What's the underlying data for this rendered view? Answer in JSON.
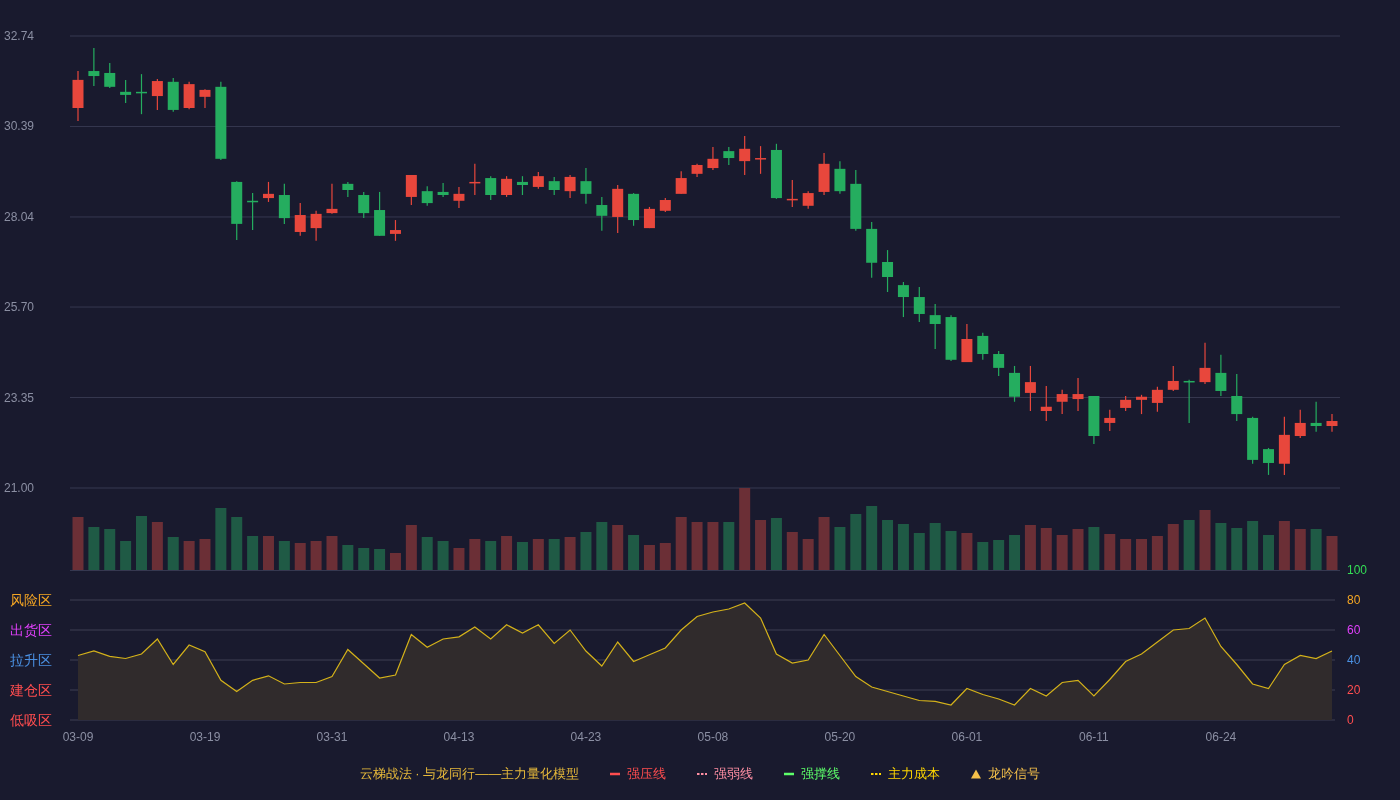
{
  "price_chart": {
    "chart_data": {
      "type": "candlestick",
      "grid": true,
      "ylim": [
        21.0,
        32.74
      ],
      "yticks": [
        {
          "value": 32.74,
          "label": "32.74"
        },
        {
          "value": 30.39,
          "label": "30.39"
        },
        {
          "value": 28.04,
          "label": "28.04"
        },
        {
          "value": 25.7,
          "label": "25.70"
        },
        {
          "value": 23.35,
          "label": "23.35"
        },
        {
          "value": 21.0,
          "label": "21.00"
        }
      ],
      "categories": [
        null,
        null,
        null,
        null,
        null,
        null,
        null,
        null,
        null,
        null,
        null,
        null,
        null,
        null,
        null,
        null,
        null,
        null,
        null,
        null,
        null,
        null,
        null,
        null,
        null,
        null,
        null,
        null,
        null,
        null,
        null,
        null,
        null,
        null,
        null,
        null,
        null,
        null,
        null,
        null,
        null,
        null,
        null,
        null,
        null,
        null,
        null,
        null,
        null,
        null,
        null,
        null,
        null,
        null,
        null,
        null,
        null,
        null,
        null,
        null,
        null,
        null,
        null,
        null,
        null,
        null,
        null,
        null,
        null,
        null,
        null,
        null,
        null,
        null,
        null,
        null,
        null,
        null,
        null,
        null
      ],
      "ohlc": [
        [
          30.87,
          31.83,
          30.53,
          31.6
        ],
        [
          31.83,
          32.43,
          31.44,
          31.7
        ],
        [
          31.78,
          32.04,
          31.39,
          31.42
        ],
        [
          31.29,
          31.6,
          31.0,
          31.21
        ],
        [
          31.29,
          31.75,
          30.71,
          31.26
        ],
        [
          31.18,
          31.62,
          30.82,
          31.57
        ],
        [
          31.55,
          31.65,
          30.77,
          30.82
        ],
        [
          30.87,
          31.55,
          30.84,
          31.49
        ],
        [
          31.16,
          31.36,
          30.87,
          31.34
        ],
        [
          31.42,
          31.55,
          29.52,
          29.55
        ],
        [
          28.95,
          28.97,
          27.44,
          27.86
        ],
        [
          28.46,
          28.66,
          27.7,
          28.43
        ],
        [
          28.53,
          28.95,
          28.43,
          28.64
        ],
        [
          28.61,
          28.9,
          27.86,
          28.01
        ],
        [
          27.65,
          28.4,
          27.55,
          28.09
        ],
        [
          27.75,
          28.2,
          27.42,
          28.12
        ],
        [
          28.14,
          28.9,
          28.12,
          28.25
        ],
        [
          28.9,
          28.95,
          28.56,
          28.74
        ],
        [
          28.61,
          28.69,
          28.01,
          28.14
        ],
        [
          28.22,
          28.69,
          27.55,
          27.55
        ],
        [
          27.6,
          27.96,
          27.42,
          27.7
        ],
        [
          28.56,
          29.13,
          28.35,
          29.13
        ],
        [
          28.71,
          28.84,
          28.33,
          28.4
        ],
        [
          28.69,
          28.92,
          28.56,
          28.61
        ],
        [
          28.46,
          28.82,
          28.27,
          28.64
        ],
        [
          28.92,
          29.42,
          28.61,
          28.95
        ],
        [
          29.05,
          29.1,
          28.48,
          28.61
        ],
        [
          28.61,
          29.1,
          28.56,
          29.03
        ],
        [
          28.95,
          29.1,
          28.61,
          28.87
        ],
        [
          28.82,
          29.21,
          28.77,
          29.1
        ],
        [
          28.97,
          29.08,
          28.61,
          28.74
        ],
        [
          28.71,
          29.13,
          28.53,
          29.08
        ],
        [
          28.97,
          29.31,
          28.38,
          28.64
        ],
        [
          28.35,
          28.56,
          27.68,
          28.07
        ],
        [
          28.04,
          28.87,
          27.62,
          28.77
        ],
        [
          28.64,
          28.66,
          27.81,
          27.96
        ],
        [
          27.75,
          28.3,
          27.75,
          28.25
        ],
        [
          28.2,
          28.53,
          28.17,
          28.48
        ],
        [
          28.64,
          29.23,
          28.64,
          29.05
        ],
        [
          29.16,
          29.42,
          29.08,
          29.39
        ],
        [
          29.31,
          29.86,
          29.26,
          29.55
        ],
        [
          29.75,
          29.86,
          29.39,
          29.57
        ],
        [
          29.49,
          30.14,
          29.13,
          29.81
        ],
        [
          29.55,
          29.88,
          29.16,
          29.57
        ],
        [
          29.78,
          29.94,
          28.51,
          28.53
        ],
        [
          28.48,
          29.0,
          28.3,
          28.51
        ],
        [
          28.33,
          28.71,
          28.25,
          28.66
        ],
        [
          28.69,
          29.7,
          28.61,
          29.42
        ],
        [
          29.29,
          29.49,
          28.64,
          28.71
        ],
        [
          28.9,
          29.26,
          27.68,
          27.73
        ],
        [
          27.73,
          27.91,
          26.46,
          26.85
        ],
        [
          26.87,
          27.18,
          26.09,
          26.48
        ],
        [
          26.27,
          26.35,
          25.44,
          25.96
        ],
        [
          25.96,
          26.22,
          25.31,
          25.52
        ],
        [
          25.49,
          25.78,
          24.61,
          25.26
        ],
        [
          25.44,
          25.49,
          24.3,
          24.33
        ],
        [
          24.27,
          25.26,
          24.27,
          24.87
        ],
        [
          24.95,
          25.03,
          24.33,
          24.48
        ],
        [
          24.48,
          24.56,
          23.91,
          24.12
        ],
        [
          23.99,
          24.17,
          23.24,
          23.37
        ],
        [
          23.47,
          24.17,
          23.0,
          23.75
        ],
        [
          23.0,
          23.65,
          22.74,
          23.11
        ],
        [
          23.24,
          23.55,
          22.92,
          23.44
        ],
        [
          23.31,
          23.86,
          23.0,
          23.44
        ],
        [
          23.39,
          23.39,
          22.14,
          22.35
        ],
        [
          22.69,
          23.03,
          22.48,
          22.82
        ],
        [
          23.08,
          23.39,
          23.0,
          23.29
        ],
        [
          23.29,
          23.42,
          22.92,
          23.37
        ],
        [
          23.21,
          23.63,
          22.98,
          23.55
        ],
        [
          23.55,
          24.17,
          23.52,
          23.78
        ],
        [
          23.78,
          23.81,
          22.69,
          23.75
        ],
        [
          23.75,
          24.77,
          23.7,
          24.12
        ],
        [
          23.99,
          24.46,
          23.39,
          23.52
        ],
        [
          23.39,
          23.96,
          22.74,
          22.92
        ],
        [
          22.82,
          22.85,
          21.63,
          21.73
        ],
        [
          22.01,
          22.04,
          21.34,
          21.65
        ],
        [
          21.63,
          22.85,
          21.34,
          22.38
        ],
        [
          22.35,
          23.03,
          22.3,
          22.69
        ],
        [
          22.69,
          23.24,
          22.46,
          22.61
        ],
        [
          22.61,
          22.92,
          22.46,
          22.74
        ]
      ]
    }
  },
  "indicator_chart": {
    "zones": [
      {
        "label": "风险区",
        "color": "#f5a623"
      },
      {
        "label": "出货区",
        "color": "#e040fb"
      },
      {
        "label": "拉升区",
        "color": "#4a90e2"
      },
      {
        "label": "建仓区",
        "color": "#ff4d4f"
      },
      {
        "label": "低吸区",
        "color": "#ff4d4f"
      }
    ],
    "chart_data": {
      "type": "area",
      "grid": true,
      "ylim": [
        0,
        100
      ],
      "categories": [
        "03-09",
        null,
        null,
        null,
        null,
        null,
        null,
        null,
        "03-19",
        null,
        null,
        null,
        null,
        null,
        null,
        null,
        "03-31",
        null,
        null,
        null,
        null,
        null,
        null,
        null,
        "04-13",
        null,
        null,
        null,
        null,
        null,
        null,
        null,
        "04-23",
        null,
        null,
        null,
        null,
        null,
        null,
        null,
        "05-08",
        null,
        null,
        null,
        null,
        null,
        null,
        null,
        "05-20",
        null,
        null,
        null,
        null,
        null,
        null,
        null,
        "06-01",
        null,
        null,
        null,
        null,
        null,
        null,
        null,
        "06-11",
        null,
        null,
        null,
        null,
        null,
        null,
        null,
        "06-24",
        null,
        null,
        null,
        null,
        null,
        null,
        null
      ],
      "yticks": [
        {
          "value": 100,
          "label": "100"
        },
        {
          "value": 80,
          "label": "80"
        },
        {
          "value": 60,
          "label": "60"
        },
        {
          "value": 40,
          "label": "40"
        },
        {
          "value": 20,
          "label": "20"
        },
        {
          "value": 0,
          "label": "0"
        }
      ],
      "series": [
        {
          "color": "#d4b21a",
          "values": [
            43,
            46,
            42.5,
            41,
            44,
            54,
            37,
            50,
            45.5,
            26.5,
            19,
            26.5,
            29.5,
            24,
            25,
            25,
            29,
            47,
            37.5,
            28,
            30,
            57,
            48.5,
            54,
            55.5,
            62,
            54,
            63.5,
            58,
            63.5,
            51,
            60,
            46,
            36,
            52,
            39,
            43.5,
            48,
            60,
            69,
            72,
            74,
            78,
            68,
            44,
            38,
            40,
            57,
            43,
            29,
            22,
            19,
            16,
            13,
            12.5,
            10,
            21,
            17,
            14,
            10,
            21,
            16,
            25,
            26.5,
            16,
            27,
            39,
            44,
            52,
            60,
            61,
            68,
            49,
            37,
            24,
            21,
            37,
            43,
            41,
            46
          ]
        }
      ]
    }
  },
  "legend": {
    "title": "云梯战法 · 与龙同行——主力量化模型",
    "items": [
      {
        "kind": "line",
        "label": "强压线",
        "color": "#ff4d4f"
      },
      {
        "kind": "dashed",
        "label": "强弱线",
        "color": "#ff8fa3"
      },
      {
        "kind": "line",
        "label": "强撑线",
        "color": "#5dff6a"
      },
      {
        "kind": "dashed",
        "label": "主力成本",
        "color": "#ffd700"
      },
      {
        "kind": "triangle",
        "label": "龙吟信号",
        "color": "#f5c04a"
      }
    ]
  }
}
